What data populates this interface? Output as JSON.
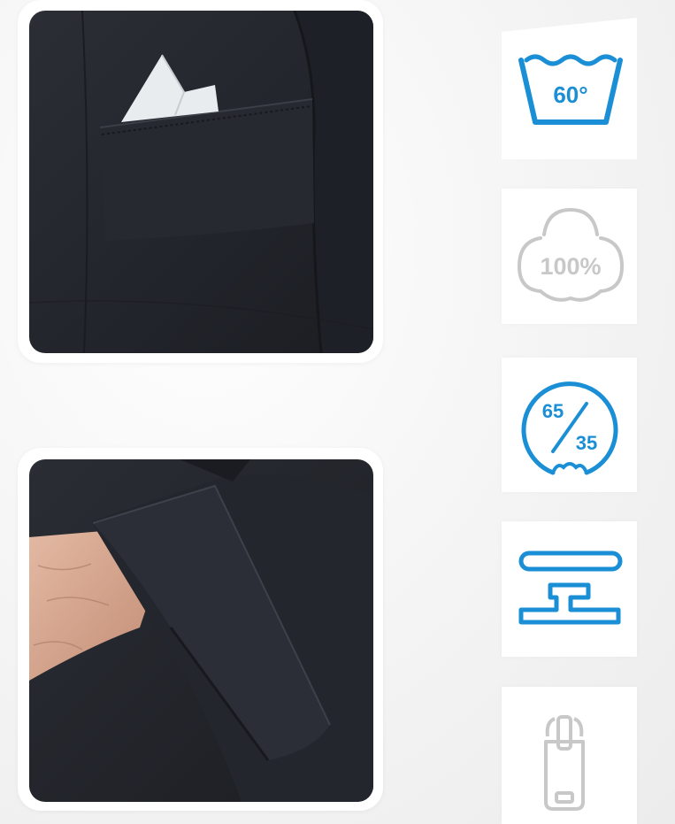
{
  "colors": {
    "accent_blue": "#1b8fd6",
    "muted_gray": "#c8c8c8",
    "fabric_dark": "#23262d",
    "background": "#f2f2f2"
  },
  "photos": [
    {
      "subject": "chest-pocket-with-pocket-square"
    },
    {
      "subject": "rolled-sleeve-cuff"
    }
  ],
  "care_icons": [
    {
      "icon": "wash-60-icon",
      "label": "60°",
      "color": "#1b8fd6"
    },
    {
      "icon": "cotton-100-icon",
      "label": "100%",
      "color": "#c8c8c8"
    },
    {
      "icon": "blend-65-35-icon",
      "top": "65",
      "bottom": "35",
      "color": "#1b8fd6"
    },
    {
      "icon": "press-stud-icon",
      "color": "#1b8fd6"
    },
    {
      "icon": "zipper-icon",
      "color": "#c8c8c8"
    }
  ]
}
